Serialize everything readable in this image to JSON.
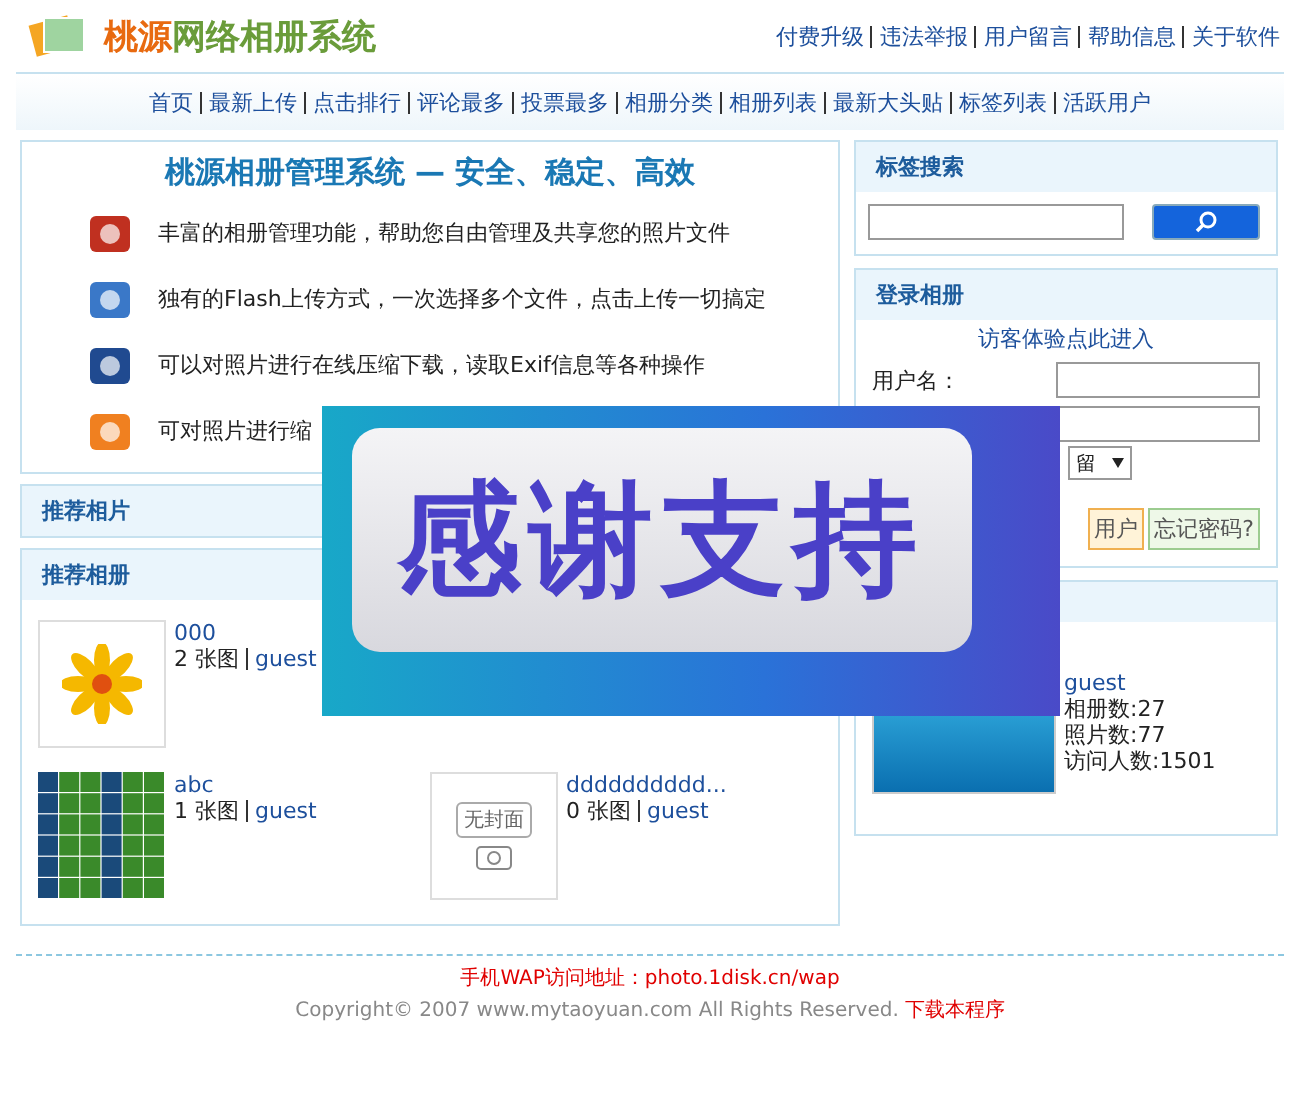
{
  "header": {
    "title_part1": "桃源",
    "title_part2": "网络相册系统",
    "links": [
      "付费升级",
      "违法举报",
      "用户留言",
      "帮助信息",
      "关于软件"
    ]
  },
  "nav": [
    "首页",
    "最新上传",
    "点击排行",
    "评论最多",
    "投票最多",
    "相册分类",
    "相册列表",
    "最新大头贴",
    "标签列表",
    "活跃用户"
  ],
  "intro": {
    "title": "桃源相册管理系统 — 安全、稳定、高效",
    "features": [
      {
        "kind": "manage",
        "text": "丰富的相册管理功能，帮助您自由管理及共享您的照片文件"
      },
      {
        "kind": "upload",
        "text": "独有的Flash上传方式，一次选择多个文件，点击上传一切搞定"
      },
      {
        "kind": "film",
        "text": "可以对照片进行在线压缩下载，读取Exif信息等各种操作"
      },
      {
        "kind": "edit",
        "text": "可对照片进行缩"
      }
    ]
  },
  "recommended_photos": {
    "title": "推荐相片"
  },
  "recommended_albums": {
    "title": "推荐相册",
    "rows": [
      [
        {
          "kind": "flower",
          "name": "000",
          "count": "2 张图",
          "user": "guest"
        }
      ],
      [
        {
          "kind": "grid",
          "name": "abc",
          "count": "1 张图",
          "user": "guest"
        },
        {
          "kind": "blank",
          "cover_text": "无封面",
          "name": "dddddddddd...",
          "count": "0 张图",
          "user": "guest"
        }
      ]
    ]
  },
  "tag_search": {
    "title": "标签搜索"
  },
  "login": {
    "title": "登录相册",
    "guest_link": "访客体验点此进入",
    "username_label": "用户名：",
    "remember": "留",
    "register_button": "用户",
    "forgot_button": "忘记密码?"
  },
  "user_card": {
    "name": "guest",
    "stats": [
      "相册数:27",
      "照片数:77",
      "访问人数:1501"
    ]
  },
  "footer": {
    "wap": "手机WAP访问地址：photo.1disk.cn/wap",
    "copyright": "Copyright© 2007 www.mytaoyuan.com All Rights Reserved.",
    "download": "下载本程序"
  },
  "banner": {
    "text": "感谢支持"
  }
}
